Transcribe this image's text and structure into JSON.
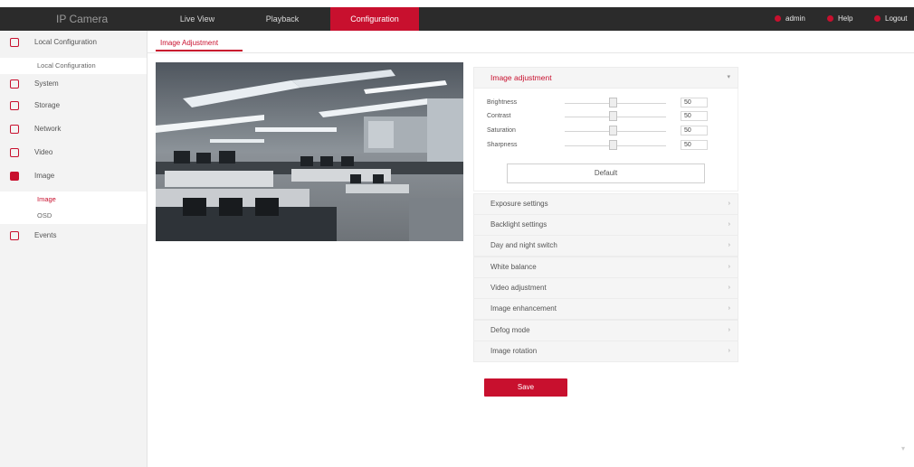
{
  "header": {
    "brand": "IP Camera",
    "nav": [
      "Live View",
      "Playback",
      "Configuration"
    ],
    "active_nav": "Configuration",
    "right_links": [
      "admin",
      "Help",
      "Logout"
    ]
  },
  "sidebar": {
    "items": [
      {
        "label": "Local Configuration",
        "icon": "monitor-icon"
      },
      {
        "label": "System",
        "icon": "system-icon"
      },
      {
        "label": "Storage",
        "icon": "storage-icon"
      },
      {
        "label": "Network",
        "icon": "network-icon"
      },
      {
        "label": "Video",
        "icon": "video-icon"
      },
      {
        "label": "Image",
        "icon": "image-icon"
      },
      {
        "label": "Events",
        "icon": "events-icon"
      }
    ],
    "subitems": {
      "local": [
        "Local Configuration"
      ],
      "image": [
        "Image",
        "OSD"
      ]
    }
  },
  "tab": {
    "label": "Image Adjustment"
  },
  "panel": {
    "title": "Image adjustment",
    "sliders": [
      {
        "label": "Brightness",
        "value": "50"
      },
      {
        "label": "Contrast",
        "value": "50"
      },
      {
        "label": "Saturation",
        "value": "50"
      },
      {
        "label": "Sharpness",
        "value": "50"
      }
    ],
    "default_label": "Default",
    "sections": [
      "Exposure settings",
      "Backlight settings",
      "Day and night switch",
      "White balance",
      "Video adjustment",
      "Image enhancement",
      "Defog mode",
      "Image rotation"
    ]
  },
  "save_label": "Save",
  "colors": {
    "accent": "#c8102e",
    "topbar": "#2b2b2b"
  }
}
